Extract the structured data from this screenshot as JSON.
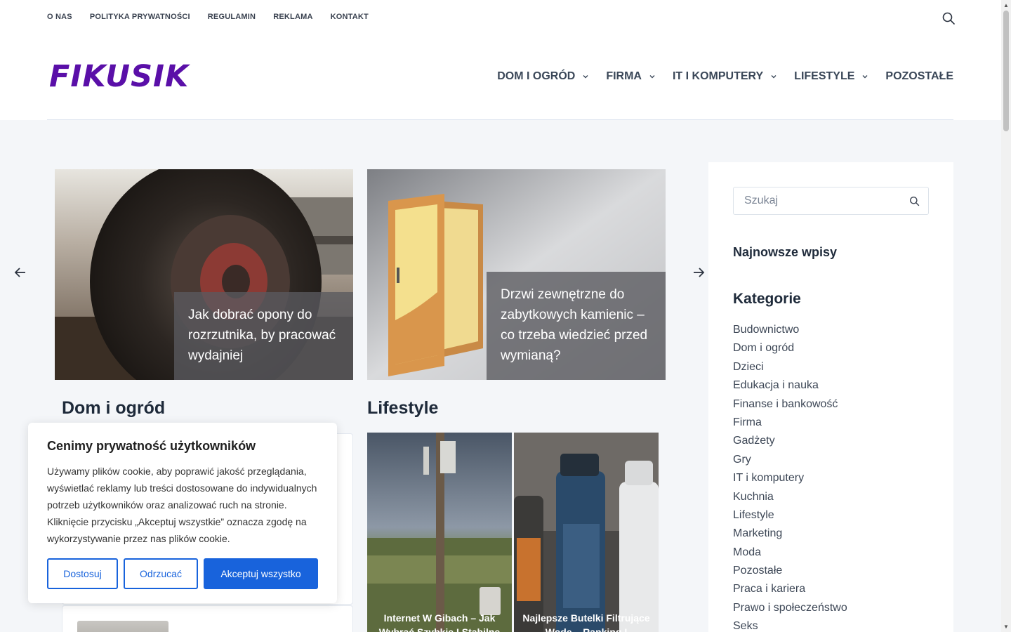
{
  "topnav": {
    "items": [
      "O NAS",
      "POLITYKA PRYWATNOŚCI",
      "REGULAMIN",
      "REKLAMA",
      "KONTAKT"
    ]
  },
  "logo": "FIKUSIK",
  "mainnav": {
    "items": [
      {
        "label": "DOM I OGRÓD",
        "has_dropdown": true
      },
      {
        "label": "FIRMA",
        "has_dropdown": true
      },
      {
        "label": "IT I KOMPUTERY",
        "has_dropdown": true
      },
      {
        "label": "LIFESTYLE",
        "has_dropdown": true
      },
      {
        "label": "POZOSTAŁE",
        "has_dropdown": false
      }
    ]
  },
  "slider": {
    "slides": [
      {
        "title": "Jak dobrać opony do rozrzutnika, by pracować wydajniej"
      },
      {
        "title": "Drzwi zewnętrzne do zabytkowych kamienic – co trzeba wiedzieć przed wymianą?"
      }
    ]
  },
  "sections": {
    "dom_title": "Dom i ogród",
    "lifestyle_title": "Lifestyle",
    "lifestyle_tiles": [
      {
        "title": "Internet W Gibach – Jak Wybrać Szybkie I Stabilne Łącze"
      },
      {
        "title": "Najlepsze Butelki Filtrujące Wodę – Ranking I Praktyczny Wybór"
      }
    ]
  },
  "sidebar": {
    "search_placeholder": "Szukaj",
    "latest_heading": "Najnowsze wpisy",
    "categories_heading": "Kategorie",
    "categories": [
      "Budownictwo",
      "Dom i ogród",
      "Dzieci",
      "Edukacja i nauka",
      "Finanse i bankowość",
      "Firma",
      "Gadżety",
      "Gry",
      "IT i komputery",
      "Kuchnia",
      "Lifestyle",
      "Marketing",
      "Moda",
      "Pozostałe",
      "Praca i kariera",
      "Prawo i społeczeństwo",
      "Seks"
    ]
  },
  "cookie": {
    "title": "Cenimy prywatność użytkowników",
    "text": "Używamy plików cookie, aby poprawić jakość przeglądania, wyświetlać reklamy lub treści dostosowane do indywidualnych potrzeb użytkowników oraz analizować ruch na stronie. Kliknięcie przycisku „Akceptuj wszystkie” oznacza zgodę na wykorzystywanie przez nas plików cookie.",
    "btn_customize": "Dostosuj",
    "btn_reject": "Odrzucać",
    "btn_accept": "Akceptuj wszystko"
  },
  "colors": {
    "brand": "#5a0fa8",
    "accent": "#1863dc"
  }
}
